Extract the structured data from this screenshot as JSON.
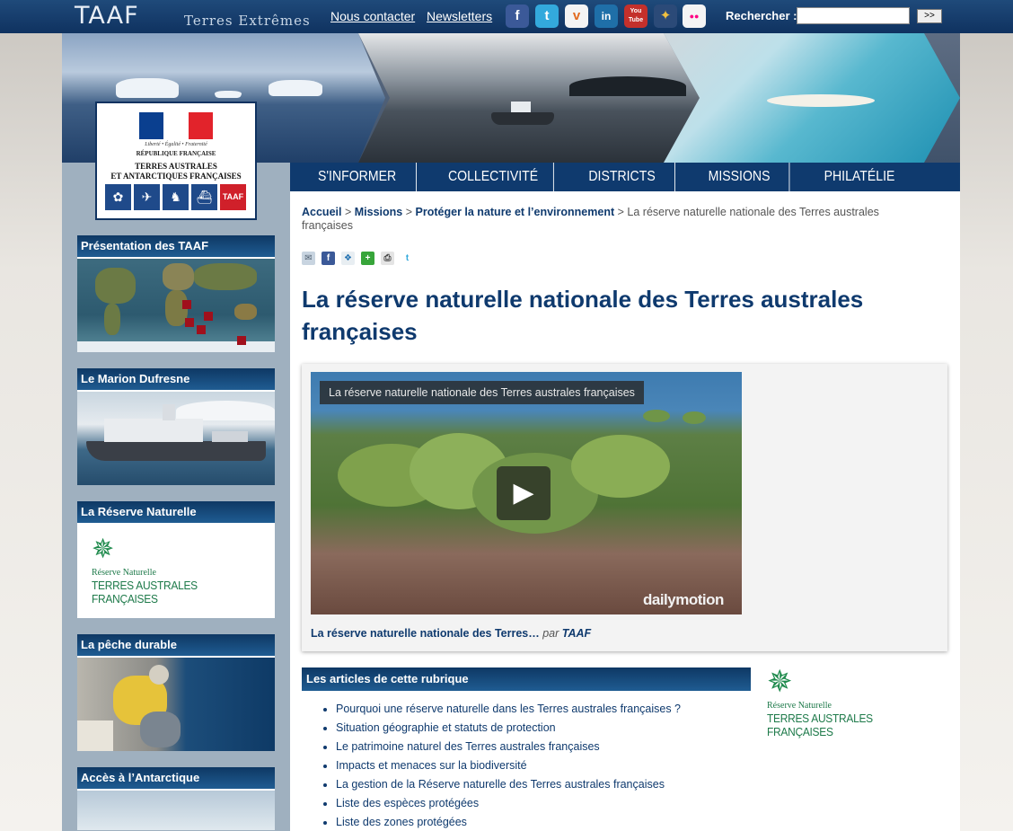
{
  "header": {
    "logo": "TAAF",
    "tagline": "Terres Extrêmes",
    "contact": "Nous contacter",
    "newsletters": "Newsletters",
    "social": [
      "f",
      "t",
      "v",
      "in",
      "You Tube",
      "✦",
      "●●"
    ],
    "search_label": "Rechercher :",
    "search_value": "",
    "search_button": ">>"
  },
  "emblem": {
    "motto": "Liberté • Égalité • Fraternité",
    "republic": "RÉPUBLIQUE FRANÇAISE",
    "name_line1": "TERRES AUSTRALES",
    "name_line2": "ET ANTARCTIQUES FRANÇAISES",
    "badge": "TAAF"
  },
  "nav": [
    "S'INFORMER",
    "COLLECTIVITÉ",
    "DISTRICTS",
    "MISSIONS",
    "PHILATÉLIE"
  ],
  "sidebar": [
    {
      "title": "Présentation des TAAF"
    },
    {
      "title": "Le Marion Dufresne"
    },
    {
      "title": "La Réserve Naturelle"
    },
    {
      "title": "La pêche durable"
    },
    {
      "title": "Accès à l’Antarctique"
    }
  ],
  "reserve_logo": {
    "sub": "Réserve Naturelle",
    "main": "TERRES AUSTRALES FRANÇAISES"
  },
  "breadcrumb": {
    "home": "Accueil",
    "missions": "Missions",
    "protect": "Protéger la nature et l’environnement",
    "current": "La réserve naturelle nationale des Terres australes françaises",
    "sep": ">"
  },
  "page": {
    "title": "La réserve naturelle nationale des Terres australes françaises"
  },
  "video": {
    "caption": "La réserve naturelle nationale des Terres australes françaises",
    "brand": "dailymotion",
    "link": "La réserve naturelle nationale des Terres…",
    "by": "par",
    "author": "TAAF"
  },
  "articles": {
    "heading": "Les articles de cette rubrique",
    "items": [
      "Pourquoi une réserve naturelle dans les Terres australes françaises ?",
      "Situation géographie et statuts de protection",
      "Le patrimoine naturel des Terres australes françaises",
      "Impacts et menaces sur la biodiversité",
      "La gestion de la Réserve naturelle des Terres australes françaises",
      "Liste des espèces protégées",
      "Liste des zones protégées"
    ]
  }
}
